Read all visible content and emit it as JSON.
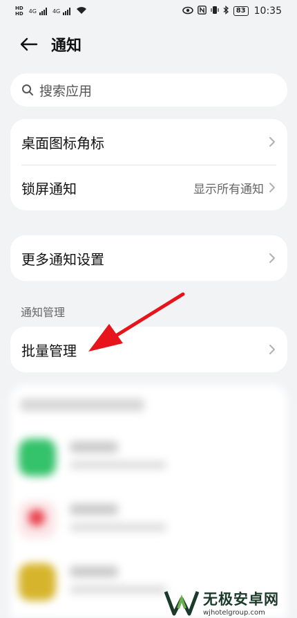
{
  "status_bar": {
    "hd_top": "HD",
    "hd_bottom": "HD",
    "net1": "4G",
    "net2": "4G",
    "battery": "83",
    "time": "10:35"
  },
  "header": {
    "title": "通知",
    "back_icon": "arrow-left-icon"
  },
  "search": {
    "placeholder": "搜索应用",
    "icon": "search-icon"
  },
  "group1": {
    "items": [
      {
        "label": "桌面图标角标",
        "value": ""
      },
      {
        "label": "锁屏通知",
        "value": "显示所有通知"
      }
    ]
  },
  "group2": {
    "items": [
      {
        "label": "更多通知设置"
      }
    ]
  },
  "section": {
    "title": "通知管理"
  },
  "group3": {
    "items": [
      {
        "label": "批量管理"
      }
    ]
  },
  "colors": {
    "background": "#f1f3f5",
    "card": "#ffffff",
    "annotation_arrow": "#e8141b",
    "app1": "#34c26a",
    "app2": "#e8404a",
    "app3": "#d6b52c"
  },
  "watermark": {
    "name": "无极安卓网",
    "url": "wjhotelgroup.com"
  }
}
